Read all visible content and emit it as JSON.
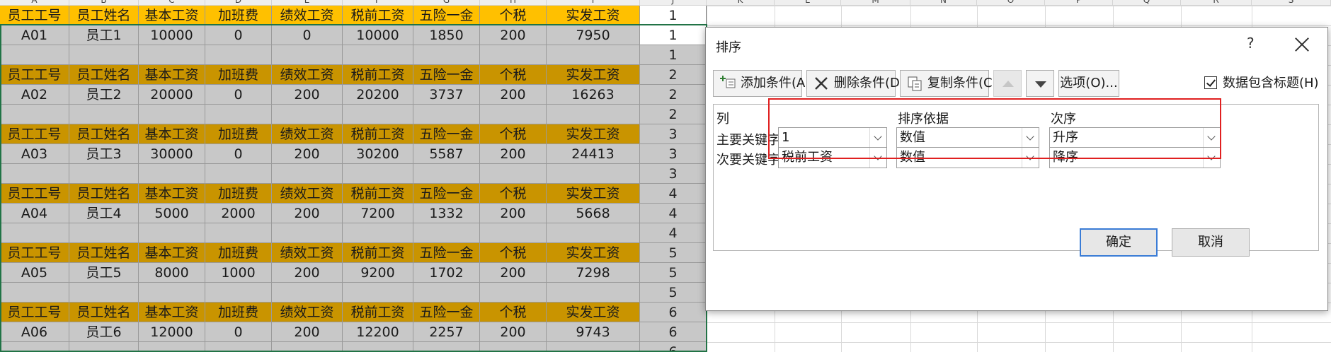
{
  "sheet": {
    "column_letters": [
      "A",
      "B",
      "C",
      "D",
      "E",
      "F",
      "G",
      "H",
      "I",
      "J",
      "K",
      "L",
      "M",
      "N",
      "O",
      "P",
      "Q",
      "R",
      "S"
    ],
    "header_labels": [
      "员工工号",
      "员工姓名",
      "基本工资",
      "加班费",
      "绩效工资",
      "税前工资",
      "五险一金",
      "个税",
      "实发工资"
    ],
    "blocks": [
      {
        "j_header": "1",
        "j_data": "1",
        "j_blank": "1",
        "cells": [
          "A01",
          "员工1",
          "10000",
          "0",
          "0",
          "10000",
          "1850",
          "200",
          "7950"
        ]
      },
      {
        "j_header": "2",
        "j_data": "2",
        "j_blank": "2",
        "cells": [
          "A02",
          "员工2",
          "20000",
          "0",
          "200",
          "20200",
          "3737",
          "200",
          "16263"
        ]
      },
      {
        "j_header": "3",
        "j_data": "3",
        "j_blank": "3",
        "cells": [
          "A03",
          "员工3",
          "30000",
          "0",
          "200",
          "30200",
          "5587",
          "200",
          "24413"
        ]
      },
      {
        "j_header": "4",
        "j_data": "4",
        "j_blank": "4",
        "cells": [
          "A04",
          "员工4",
          "5000",
          "2000",
          "200",
          "7200",
          "1332",
          "200",
          "5668"
        ]
      },
      {
        "j_header": "5",
        "j_data": "5",
        "j_blank": "5",
        "cells": [
          "A05",
          "员工5",
          "8000",
          "1000",
          "200",
          "9200",
          "1702",
          "200",
          "7298"
        ]
      },
      {
        "j_header": "6",
        "j_data": "6",
        "j_blank": "6",
        "cells": [
          "A06",
          "员工6",
          "12000",
          "0",
          "200",
          "12200",
          "2257",
          "200",
          "9743"
        ]
      }
    ]
  },
  "dialog": {
    "title": "排序",
    "help": "?",
    "buttons": {
      "add": "添加条件(A)",
      "delete": "删除条件(D)",
      "copy": "复制条件(C)",
      "options": "选项(O)...",
      "ok": "确定",
      "cancel": "取消"
    },
    "has_headers_label": "数据包含标题(H)",
    "has_headers_checked": true,
    "columns": {
      "col": "列",
      "sort_on": "排序依据",
      "order": "次序"
    },
    "levels": [
      {
        "label": "主要关键字",
        "column": "1",
        "sort_on": "数值",
        "order": "升序"
      },
      {
        "label": "次要关键字",
        "column": "税前工资",
        "sort_on": "数值",
        "order": "降序"
      }
    ],
    "accent_color": "#3a7cd6",
    "highlight_color": "#e02020"
  },
  "colors": {
    "header_fill": "#c99400",
    "first_header_fill": "#ffc000",
    "selection_fill": "#c8c8c8",
    "selection_border": "#217346"
  }
}
